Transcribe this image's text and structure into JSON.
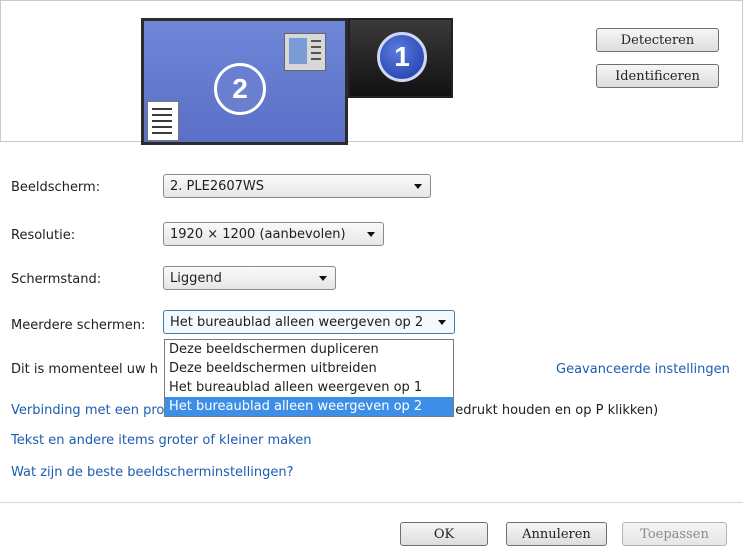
{
  "preview": {
    "monitor2_number": "2",
    "monitor1_number": "1",
    "detect_label": "Detecteren",
    "identify_label": "Identificeren"
  },
  "settings": {
    "display_label": "Beeldscherm:",
    "display_value": "2. PLE2607WS",
    "resolution_label": "Resolutie:",
    "resolution_value": "1920 × 1200 (aanbevolen)",
    "orientation_label": "Schermstand:",
    "orientation_value": "Liggend",
    "multiple_label": "Meerdere schermen:",
    "multiple_value": "Het bureaublad alleen weergeven op 2",
    "multiple_options": [
      "Deze beeldschermen dupliceren",
      "Deze beeldschermen uitbreiden",
      "Het bureaublad alleen weergeven op 1",
      "Het bureaublad alleen weergeven op 2"
    ],
    "selected_option_index": 3
  },
  "info": {
    "current_prefix": "Dit is momenteel uw h",
    "advanced_link": "Geavanceerde instellingen"
  },
  "links": {
    "projector_partial": "Verbinding met een pro",
    "projector_suffix": "gedrukt houden en op P klikken)",
    "text_size": "Tekst en andere items groter of kleiner maken",
    "best_settings": "Wat zijn de beste beeldscherminstellingen?"
  },
  "footer": {
    "ok_label": "OK",
    "cancel_label": "Annuleren",
    "apply_label": "Toepassen"
  },
  "colors": {
    "monitor2_fill": "#6a7fd0",
    "link": "#1d5db0",
    "selection": "#3d8ee6"
  }
}
